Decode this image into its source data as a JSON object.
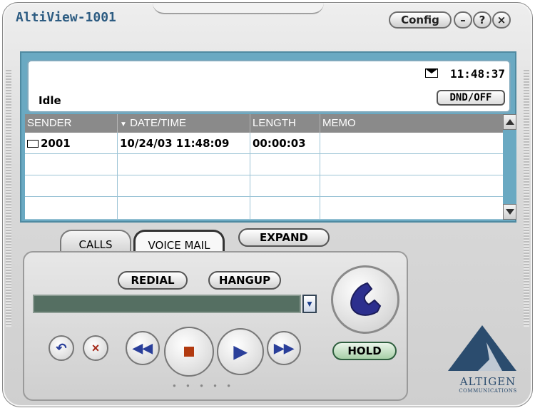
{
  "window": {
    "title": "AltiView-1001"
  },
  "titlebar": {
    "config_label": "Config",
    "minimize_label": "–",
    "help_label": "?",
    "close_label": "×"
  },
  "status": {
    "state": "Idle",
    "time": "11:48:37",
    "dnd_label": "DND/OFF"
  },
  "table": {
    "columns": [
      "SENDER",
      "DATE/TIME",
      "LENGTH",
      "MEMO"
    ],
    "sort_indicator": "▼",
    "rows": [
      {
        "sender": "2001",
        "datetime": "10/24/03 11:48:09",
        "length": "00:00:03",
        "memo": ""
      }
    ]
  },
  "tabs": {
    "calls": "CALLS",
    "voice_mail": "VOICE MAIL",
    "active": "voice_mail"
  },
  "controls": {
    "expand_label": "EXPAND",
    "redial_label": "REDIAL",
    "hangup_label": "HANGUP",
    "hold_label": "HOLD",
    "dial_input_value": ""
  },
  "icons": [
    "envelope-icon",
    "phone-icon",
    "undo-icon",
    "delete-icon",
    "rewind-icon",
    "stop-icon",
    "play-icon",
    "fast-forward-icon"
  ],
  "brand": {
    "name": "ALTIGEN",
    "sub": "COMMUNICATIONS",
    "accent": "#6aa9c2",
    "logo_color": "#2b4c6e"
  }
}
